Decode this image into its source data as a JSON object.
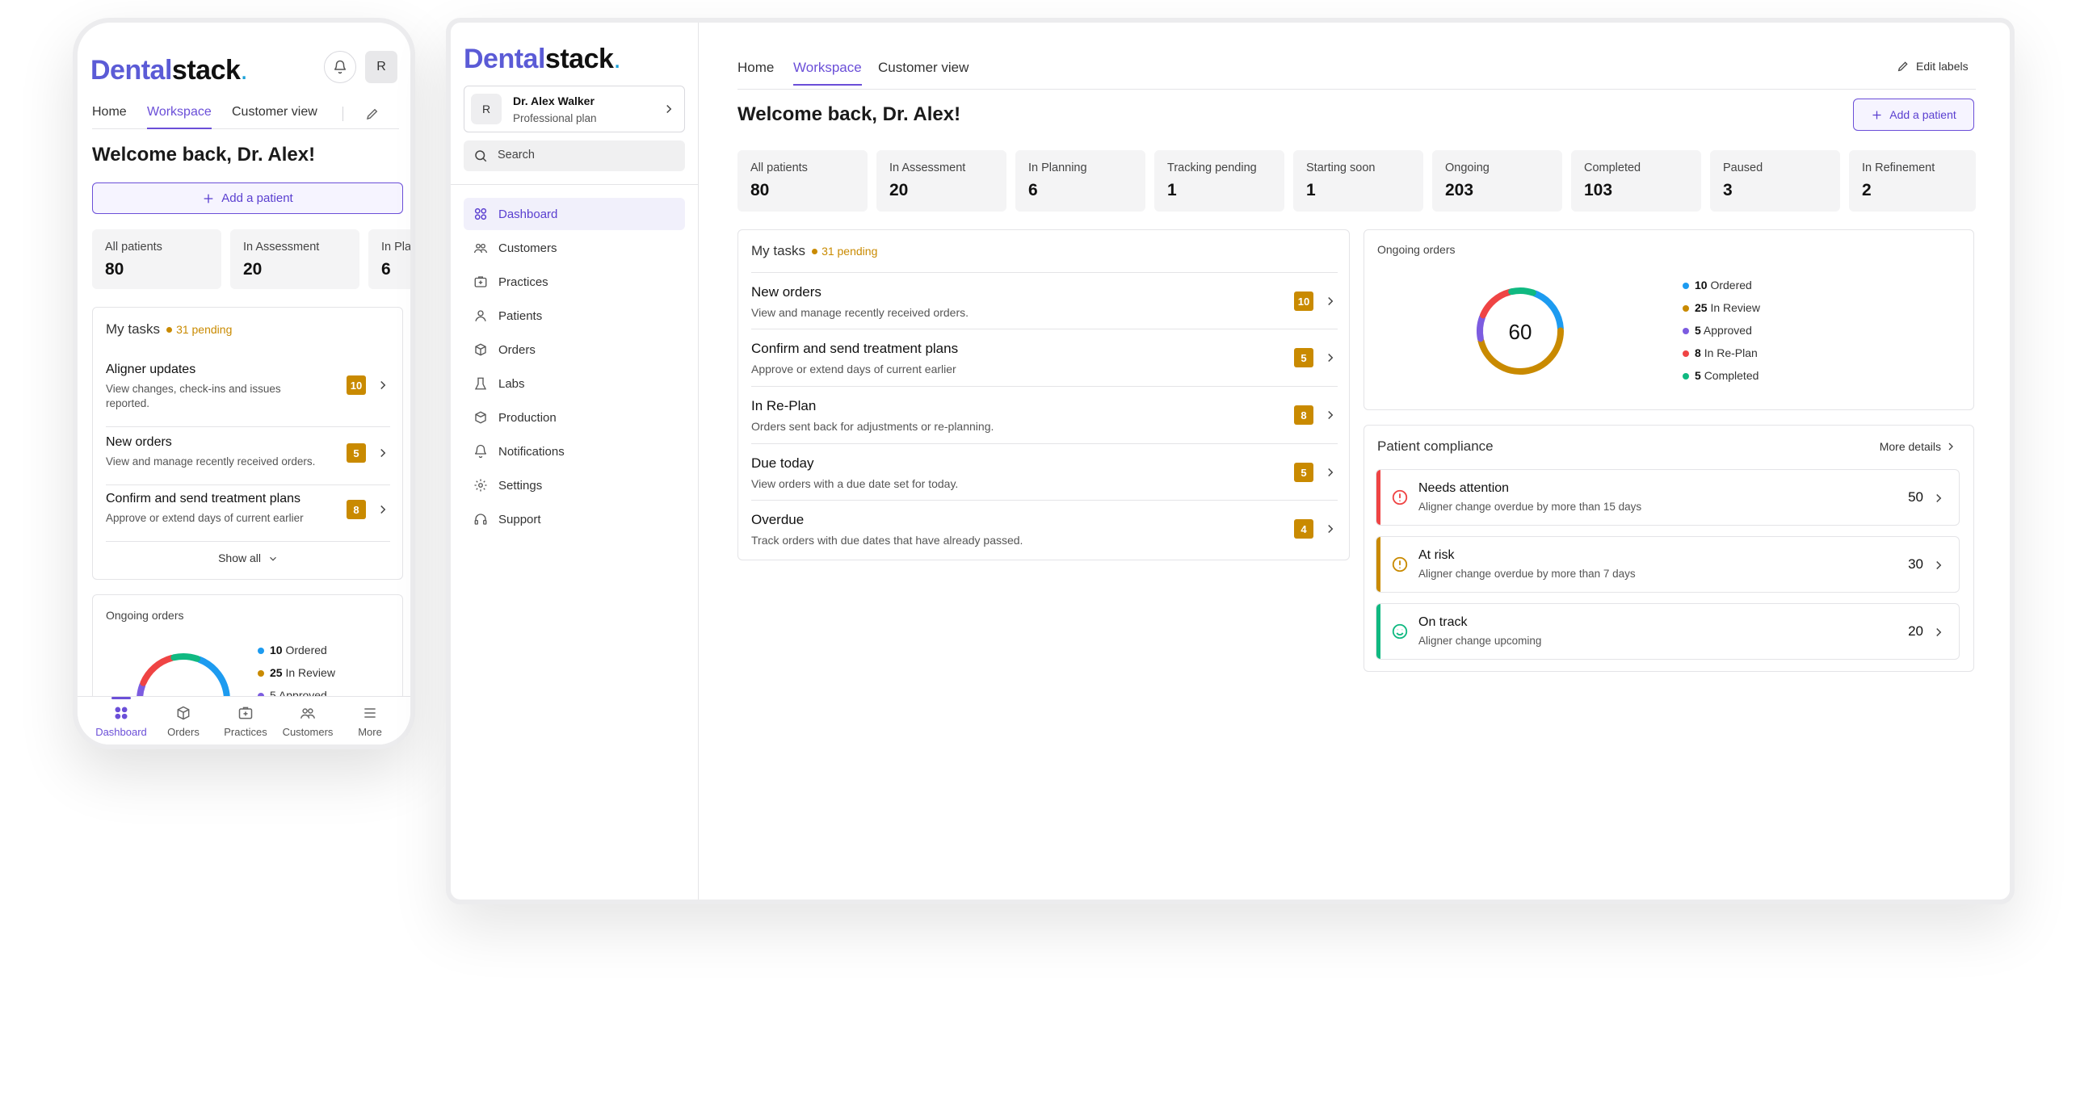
{
  "brand": {
    "part1": "Dental",
    "part2": "stack",
    "dot": "."
  },
  "tabs": [
    "Home",
    "Workspace",
    "Customer view"
  ],
  "edit_labels": "Edit labels",
  "user": {
    "initial": "R",
    "name": "Dr. Alex Walker",
    "plan": "Professional plan",
    "avatar_initial": "R"
  },
  "search": {
    "placeholder": "Search"
  },
  "sidebar": {
    "items": [
      {
        "label": "Dashboard",
        "icon": "dashboard-icon"
      },
      {
        "label": "Customers",
        "icon": "customers-icon"
      },
      {
        "label": "Practices",
        "icon": "practices-icon"
      },
      {
        "label": "Patients",
        "icon": "patients-icon"
      },
      {
        "label": "Orders",
        "icon": "orders-icon"
      },
      {
        "label": "Labs",
        "icon": "labs-icon"
      },
      {
        "label": "Production",
        "icon": "production-icon"
      },
      {
        "label": "Notifications",
        "icon": "notifications-icon"
      },
      {
        "label": "Settings",
        "icon": "settings-icon"
      },
      {
        "label": "Support",
        "icon": "support-icon"
      }
    ]
  },
  "welcome": "Welcome back, Dr. Alex!",
  "add_patient": "Add a patient",
  "stats": [
    {
      "label": "All patients",
      "value": "80"
    },
    {
      "label": "In Assessment",
      "value": "20"
    },
    {
      "label": "In Planning",
      "value": "6"
    },
    {
      "label": "Tracking pending",
      "value": "1"
    },
    {
      "label": "Starting soon",
      "value": "1"
    },
    {
      "label": "Ongoing",
      "value": "203"
    },
    {
      "label": "Completed",
      "value": "103"
    },
    {
      "label": "Paused",
      "value": "3"
    },
    {
      "label": "In Refinement",
      "value": "2"
    }
  ],
  "phone_stat_cut_label": "In Plan",
  "tasks": {
    "title": "My tasks",
    "pending": "31 pending",
    "items": [
      {
        "title": "New orders",
        "sub": "View and manage recently received orders.",
        "count": "10"
      },
      {
        "title": "Confirm and send treatment plans",
        "sub": "Approve or extend days of current earlier",
        "count": "5"
      },
      {
        "title": "In Re-Plan",
        "sub": "Orders sent back for adjustments or re-planning.",
        "count": "8"
      },
      {
        "title": "Due today",
        "sub": "View orders with a due date set for today.",
        "count": "5"
      },
      {
        "title": "Overdue",
        "sub": "Track orders with due dates that have already passed.",
        "count": "4"
      }
    ]
  },
  "phone_tasks": [
    {
      "title": "Aligner updates",
      "sub": "View changes, check-ins and issues reported.",
      "count": "10"
    },
    {
      "title": "New orders",
      "sub": "View and manage recently received orders.",
      "count": "5"
    },
    {
      "title": "Confirm and send treatment plans",
      "sub": "Approve or extend days of current earlier",
      "count": "8"
    }
  ],
  "show_all": "Show all",
  "ongoing": {
    "title": "Ongoing orders",
    "total": "60",
    "legend": [
      {
        "count": "10",
        "label": "Ordered",
        "color": "#1d9bf0"
      },
      {
        "count": "25",
        "label": "In Review",
        "color": "#c98a00"
      },
      {
        "count": "5",
        "label": "Approved",
        "color": "#7c5ce0"
      },
      {
        "count": "8",
        "label": "In Re-Plan",
        "color": "#ef4444"
      },
      {
        "count": "5",
        "label": "Completed",
        "color": "#10b981"
      }
    ]
  },
  "phone_legend_cut": "5 Approved",
  "compliance": {
    "title": "Patient compliance",
    "more": "More details",
    "items": [
      {
        "title": "Needs attention",
        "sub": "Aligner change overdue by more than 15 days",
        "value": "50",
        "color": "#ef4444",
        "icon": "alert-circle-icon"
      },
      {
        "title": "At risk",
        "sub": "Aligner change overdue by more than 7 days",
        "value": "30",
        "color": "#c98a00",
        "icon": "warning-circle-icon"
      },
      {
        "title": "On track",
        "sub": "Aligner change upcoming",
        "value": "20",
        "color": "#10b981",
        "icon": "smile-icon"
      }
    ]
  },
  "bottom_nav": [
    {
      "label": "Dashboard",
      "icon": "dashboard-icon"
    },
    {
      "label": "Orders",
      "icon": "orders-icon"
    },
    {
      "label": "Practices",
      "icon": "practices-icon"
    },
    {
      "label": "Customers",
      "icon": "customers-icon"
    },
    {
      "label": "More",
      "icon": "menu-icon"
    }
  ]
}
